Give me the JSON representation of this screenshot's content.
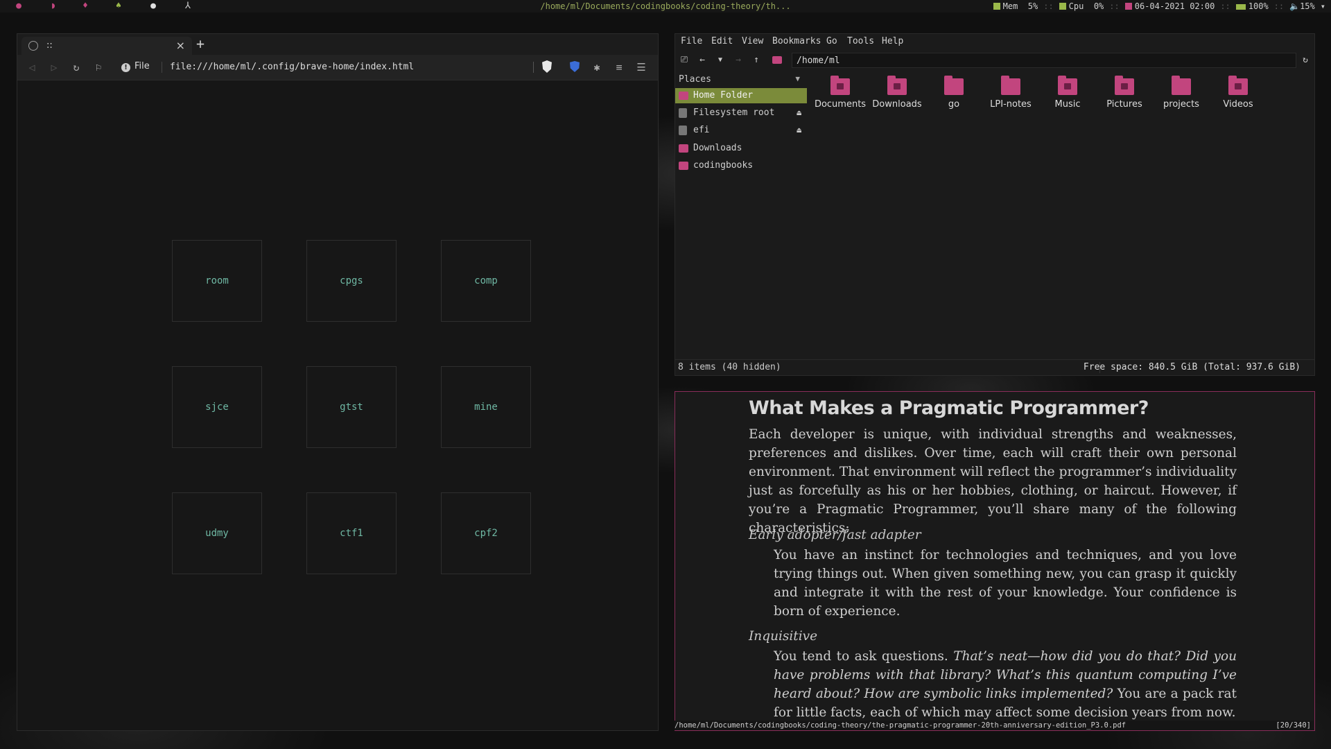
{
  "topbar": {
    "window_title": "/home/ml/Documents/codingbooks/coding-theory/th...",
    "mem_label": "Mem",
    "mem_value": "5%",
    "cpu_label": "Cpu",
    "cpu_value": "0%",
    "datetime": "06-04-2021 02:00",
    "battery": "100%",
    "volume": "15%",
    "separator": "::",
    "workspace_colors": [
      "#c2457e",
      "#c2457e",
      "#c2457e",
      "#9ab84a",
      "#e0e0e0",
      "#cfcfcf"
    ]
  },
  "browser": {
    "tab_title": "::",
    "close_glyph": "×",
    "new_tab_glyph": "+",
    "site_info_label": "File",
    "url": "file:///home/ml/.config/brave-home/index.html",
    "tiles": [
      {
        "label": "room"
      },
      {
        "label": "cpgs"
      },
      {
        "label": "comp"
      },
      {
        "label": "sjce"
      },
      {
        "label": "gtst"
      },
      {
        "label": "mine"
      },
      {
        "label": "udmy"
      },
      {
        "label": "ctf1"
      },
      {
        "label": "cpf2"
      }
    ]
  },
  "file_manager": {
    "menu": [
      "File",
      "Edit",
      "View",
      "Bookmarks",
      "Go",
      "Tools",
      "Help"
    ],
    "path": "/home/ml",
    "places_header": "Places",
    "places": [
      {
        "label": "Home Folder",
        "selected": true,
        "icon": "home-folder-icon"
      },
      {
        "label": "Filesystem root",
        "eject": true,
        "icon": "drive-icon"
      },
      {
        "label": "efi",
        "eject": true,
        "icon": "drive-icon"
      },
      {
        "label": "Downloads",
        "icon": "folder-icon"
      },
      {
        "label": "codingbooks",
        "icon": "folder-icon"
      }
    ],
    "items": [
      {
        "label": "Documents"
      },
      {
        "label": "Downloads"
      },
      {
        "label": "go"
      },
      {
        "label": "LPI-notes"
      },
      {
        "label": "Music"
      },
      {
        "label": "Pictures"
      },
      {
        "label": "projects"
      },
      {
        "label": "Videos"
      }
    ],
    "status_items": "8 items (40 hidden)",
    "status_free": "Free space: 840.5 GiB (Total: 937.6 GiB)",
    "accent_color": "#c2457e",
    "selection_color": "#7b8b3a"
  },
  "pdf": {
    "heading": "What Makes a Pragmatic Programmer?",
    "intro": "Each developer is unique, with individual strengths and weaknesses, prefer­ences and dislikes. Over time, each will craft their own personal environment. That environment will reflect the programmer’s individuality just as forcefully as his or her hobbies, clothing, or haircut. However, if you’re a Pragmatic Programmer, you’ll share many of the following characteristics:",
    "term1": "Early adopter/fast adapter",
    "def1": "You have an instinct for technologies and techniques, and you love trying things out. When given something new, you can grasp it quickly and integrate it with the rest of your knowledge. Your confidence is born of experience.",
    "term2": "Inquisitive",
    "def2_start": "You tend to ask questions.",
    "def2_italic": "That’s neat—how did you do that? Did you have problems with that library? What’s this quantum computing I’ve heard about? How are symbolic links implemented?",
    "def2_end": "You are a pack rat for little facts, each of which may affect some decision years from now.",
    "file_path": "/home/ml/Documents/codingbooks/coding-theory/the-pragmatic-programmer-20th-anniversary-edition_P3.0.pdf",
    "page_indicator": "[20/340]",
    "border_color": "#8a2d5a"
  }
}
